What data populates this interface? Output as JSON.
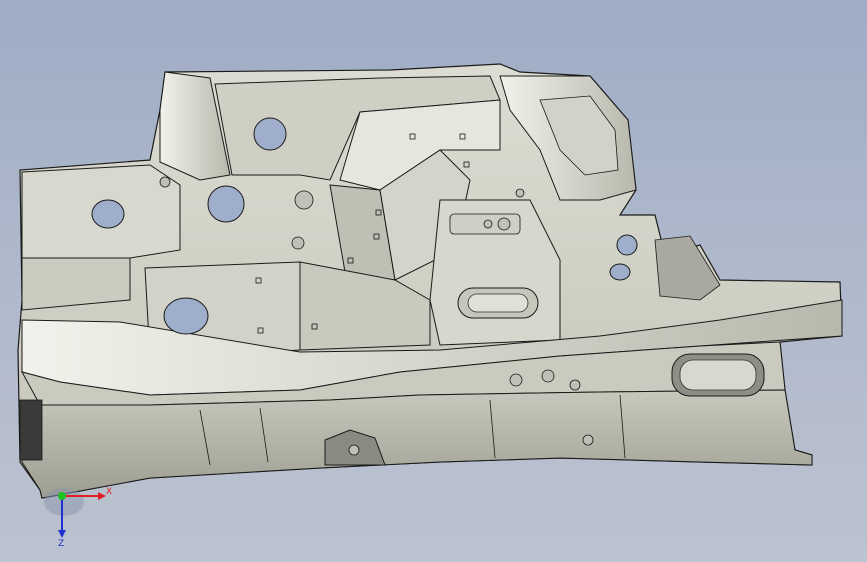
{
  "viewport": {
    "background_top": "#9eacc4",
    "background_bottom": "#bcc2cf",
    "model_face_color": "#d4d4c9",
    "model_shade_color": "#b9b9ad",
    "model_edge_color": "#1a1a1a"
  },
  "triad": {
    "x_label": "X",
    "z_label": "Z",
    "x_color": "#e02020",
    "y_color": "#20c020",
    "z_color": "#2030d0",
    "icon": "coordinate-triad-icon"
  }
}
